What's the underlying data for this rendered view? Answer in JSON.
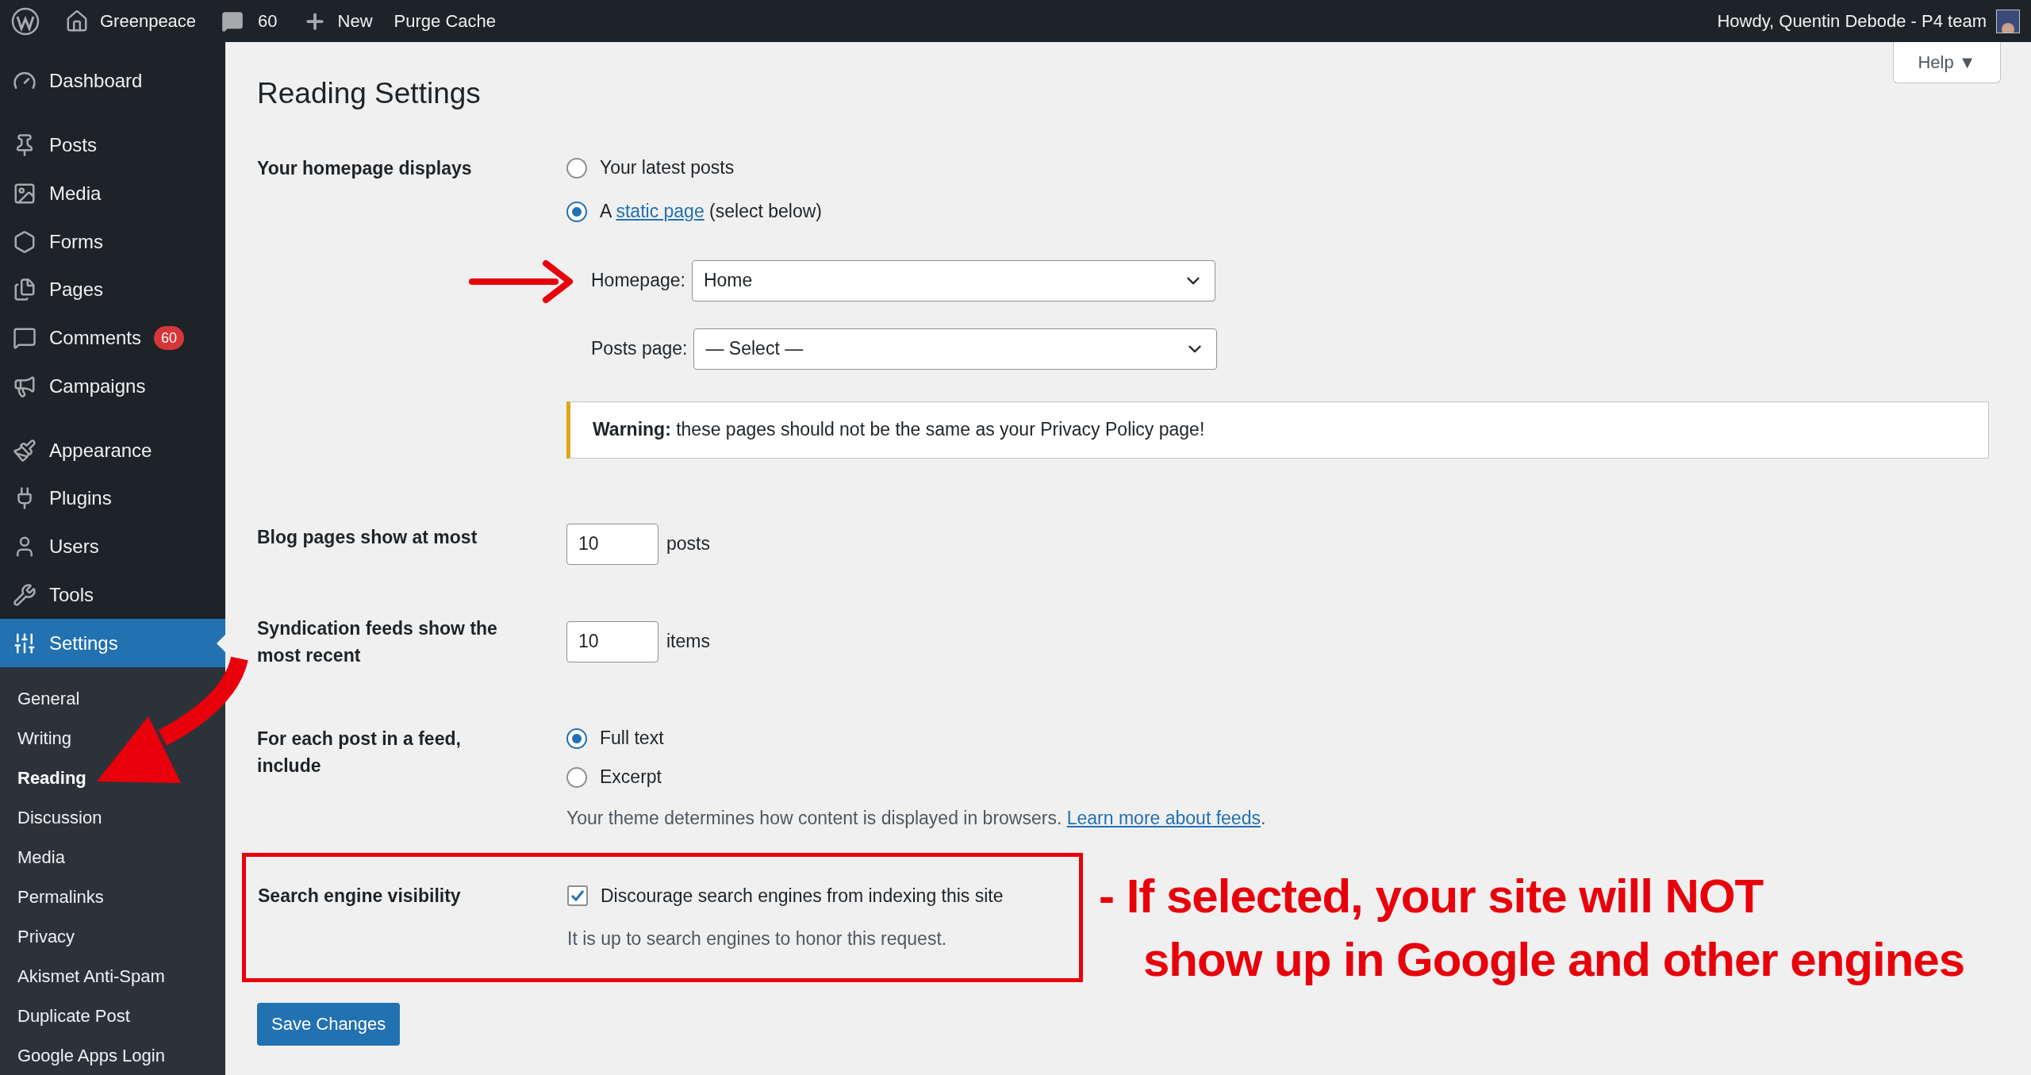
{
  "top_bar": {
    "site": "Greenpeace",
    "comments": "60",
    "new": "New",
    "purge": "Purge Cache",
    "greeting": "Howdy, Quentin Debode - P4 team"
  },
  "sidebar": {
    "items": [
      {
        "label": "Dashboard",
        "selected": false,
        "gap_after": true
      },
      {
        "label": "Posts",
        "selected": false
      },
      {
        "label": "Media",
        "selected": false
      },
      {
        "label": "Forms",
        "selected": false
      },
      {
        "label": "Pages",
        "selected": false
      },
      {
        "label": "Comments",
        "selected": false,
        "badge": "60"
      },
      {
        "label": "Campaigns",
        "selected": false,
        "gap_after": true
      },
      {
        "label": "Appearance",
        "selected": false
      },
      {
        "label": "Plugins",
        "selected": false
      },
      {
        "label": "Users",
        "selected": false
      },
      {
        "label": "Tools",
        "selected": false
      },
      {
        "label": "Settings",
        "selected": true
      }
    ],
    "submenu": [
      {
        "label": "General",
        "selected": false
      },
      {
        "label": "Writing",
        "selected": false
      },
      {
        "label": "Reading",
        "selected": true
      },
      {
        "label": "Discussion",
        "selected": false
      },
      {
        "label": "Media",
        "selected": false
      },
      {
        "label": "Permalinks",
        "selected": false
      },
      {
        "label": "Privacy",
        "selected": false
      },
      {
        "label": "Akismet Anti-Spam",
        "selected": false
      },
      {
        "label": "Duplicate Post",
        "selected": false
      },
      {
        "label": "Google Apps Login",
        "selected": false
      }
    ]
  },
  "help": "Help ▼",
  "title": "Reading Settings",
  "rows": [
    {
      "kind": "homepage",
      "label": "Your homepage displays",
      "options": [
        {
          "text": "Your latest posts",
          "selected": false
        },
        {
          "text": "A ",
          "link": "static page",
          "after": " (select below)",
          "selected": true
        }
      ],
      "selects": [
        {
          "label": "Homepage:",
          "value": "Home"
        },
        {
          "label": "Posts page:",
          "value": "— Select —"
        }
      ],
      "warning": "**Warning:** these pages should not be the same as your Privacy Policy page!"
    },
    {
      "kind": "number",
      "label": "Blog pages show at most",
      "value": "10",
      "unit": "posts"
    },
    {
      "kind": "number",
      "label": "Syndication feeds show the most recent",
      "value": "10",
      "unit": "items"
    },
    {
      "kind": "radio",
      "label": "For each post in a feed, include",
      "options": [
        {
          "text": "Full text",
          "selected": true
        },
        {
          "text": "Excerpt",
          "selected": false
        }
      ],
      "note": "Your theme determines how content is displayed in browsers.",
      "note_link": "Learn more about feeds",
      "note_end": "."
    },
    {
      "kind": "checkbox",
      "label": "Search engine visibility",
      "text": "Discourage search engines from indexing this site",
      "checked": true,
      "description": "It is up to search engines to honor this request.",
      "highlighted": true
    }
  ],
  "save": "Save Changes",
  "annotation": {
    "line_1": "- If selected, your site will NOT",
    "line_2": "show up in Google and other engines"
  }
}
